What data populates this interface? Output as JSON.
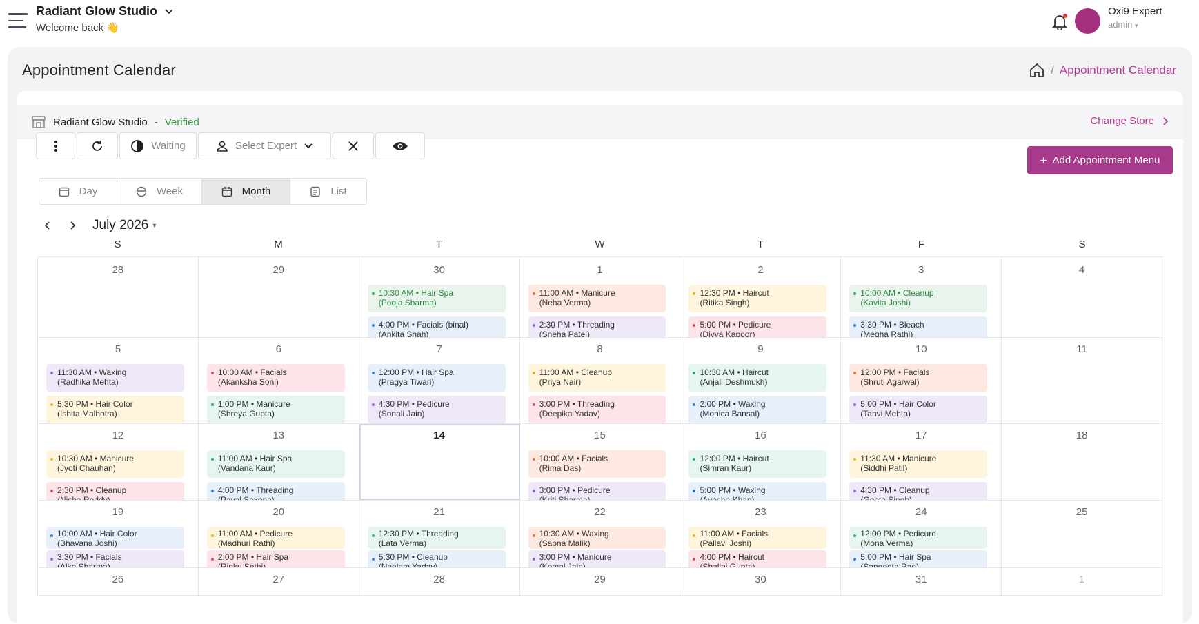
{
  "header": {
    "studio": "Radiant Glow Studio",
    "welcome": "Welcome back 👋",
    "user_name": "Oxi9 Expert",
    "user_role": "admin"
  },
  "page": {
    "title": "Appointment Calendar",
    "breadcrumb_sep": "/",
    "breadcrumb_current": "Appointment Calendar"
  },
  "store": {
    "name": "Radiant Glow Studio",
    "dash": "-",
    "status": "Verified",
    "change": "Change Store"
  },
  "toolbar": {
    "waiting": "Waiting",
    "select_expert": "Select Expert",
    "add_label": "Add Appointment Menu"
  },
  "views": [
    "Day",
    "Week",
    "Month",
    "List"
  ],
  "calendar": {
    "month_label": "July 2026",
    "dow": [
      "S",
      "M",
      "T",
      "W",
      "T",
      "F",
      "S"
    ],
    "weeks": [
      [
        {
          "d": "28",
          "muted": false,
          "appts": []
        },
        {
          "d": "29",
          "muted": false,
          "appts": []
        },
        {
          "d": "30",
          "appts": [
            {
              "t": "10:30 AM • Hair Spa",
              "n": "(Pooja Sharma)",
              "c": "green"
            },
            {
              "t": "4:00 PM • Facials (binal)",
              "n": "(Ankita Shah)",
              "c": "blue"
            }
          ]
        },
        {
          "d": "1",
          "appts": [
            {
              "t": "11:00 AM • Manicure",
              "n": "(Neha Verma)",
              "c": "orange"
            },
            {
              "t": "2:30 PM • Threading",
              "n": "(Sneha Patel)",
              "c": "purple"
            }
          ]
        },
        {
          "d": "2",
          "appts": [
            {
              "t": "12:30 PM • Haircut",
              "n": "(Ritika Singh)",
              "c": "yellow"
            },
            {
              "t": "5:00 PM • Pedicure",
              "n": "(Divya Kapoor)",
              "c": "pink"
            }
          ]
        },
        {
          "d": "3",
          "appts": [
            {
              "t": "10:00 AM • Cleanup",
              "n": "(Kavita Joshi)",
              "c": "green"
            },
            {
              "t": "3:30 PM • Bleach",
              "n": "(Megha Rathi)",
              "c": "blue"
            }
          ]
        },
        {
          "d": "4",
          "appts": []
        }
      ],
      [
        {
          "d": "5",
          "appts": [
            {
              "t": "11:30 AM • Waxing",
              "n": "(Radhika Mehta)",
              "c": "purple"
            },
            {
              "t": "5:30 PM • Hair Color",
              "n": "(Ishita Malhotra)",
              "c": "yellow"
            }
          ]
        },
        {
          "d": "6",
          "appts": [
            {
              "t": "10:00 AM • Facials",
              "n": "(Akanksha Soni)",
              "c": "pink"
            },
            {
              "t": "1:00 PM • Manicure",
              "n": "(Shreya Gupta)",
              "c": "teal"
            }
          ]
        },
        {
          "d": "7",
          "appts": [
            {
              "t": "12:00 PM • Hair Spa",
              "n": "(Pragya Tiwari)",
              "c": "blue"
            },
            {
              "t": "4:30 PM • Pedicure",
              "n": "(Sonali Jain)",
              "c": "purple"
            }
          ]
        },
        {
          "d": "8",
          "appts": [
            {
              "t": "11:00 AM • Cleanup",
              "n": "(Priya Nair)",
              "c": "yellow"
            },
            {
              "t": "3:00 PM • Threading",
              "n": "(Deepika Yadav)",
              "c": "pink"
            }
          ]
        },
        {
          "d": "9",
          "appts": [
            {
              "t": "10:30 AM • Haircut",
              "n": "(Anjali Deshmukh)",
              "c": "teal"
            },
            {
              "t": "2:00 PM • Waxing",
              "n": "(Monica Bansal)",
              "c": "blue"
            }
          ]
        },
        {
          "d": "10",
          "appts": [
            {
              "t": "12:00 PM • Facials",
              "n": "(Shruti Agarwal)",
              "c": "orange"
            },
            {
              "t": "5:00 PM • Hair Color",
              "n": "(Tanvi Mehta)",
              "c": "purple"
            }
          ]
        },
        {
          "d": "11",
          "appts": []
        }
      ],
      [
        {
          "d": "12",
          "appts": [
            {
              "t": "10:30 AM • Manicure",
              "n": "(Jyoti Chauhan)",
              "c": "yellow"
            },
            {
              "t": "2:30 PM • Cleanup",
              "n": "(Nisha Reddy)",
              "c": "pink"
            }
          ]
        },
        {
          "d": "13",
          "appts": [
            {
              "t": "11:00 AM • Hair Spa",
              "n": "(Vandana Kaur)",
              "c": "teal"
            },
            {
              "t": "4:00 PM • Threading",
              "n": "(Payal Saxena)",
              "c": "blue"
            }
          ]
        },
        {
          "d": "14",
          "today": true,
          "appts": []
        },
        {
          "d": "15",
          "appts": [
            {
              "t": "10:00 AM • Facials",
              "n": "(Rima Das)",
              "c": "orange"
            },
            {
              "t": "3:00 PM • Pedicure",
              "n": "(Kriti Sharma)",
              "c": "purple"
            }
          ]
        },
        {
          "d": "16",
          "appts": [
            {
              "t": "12:00 PM • Haircut",
              "n": "(Simran Kaur)",
              "c": "teal"
            },
            {
              "t": "5:00 PM • Waxing",
              "n": "(Ayesha Khan)",
              "c": "blue"
            }
          ]
        },
        {
          "d": "17",
          "appts": [
            {
              "t": "11:30 AM • Manicure",
              "n": "(Siddhi Patil)",
              "c": "yellow"
            },
            {
              "t": "4:30 PM • Cleanup",
              "n": "(Geeta Singh)",
              "c": "purple"
            }
          ]
        },
        {
          "d": "18",
          "appts": []
        }
      ],
      [
        {
          "d": "19",
          "appts": [
            {
              "t": "10:00 AM • Hair Color",
              "n": "(Bhavana Joshi)",
              "c": "blue"
            },
            {
              "t": "3:30 PM • Facials",
              "n": "(Alka Sharma)",
              "c": "purple"
            }
          ]
        },
        {
          "d": "20",
          "appts": [
            {
              "t": "11:00 AM • Pedicure",
              "n": "(Madhuri Rathi)",
              "c": "yellow"
            },
            {
              "t": "2:00 PM • Hair Spa",
              "n": "(Rinku Sethi)",
              "c": "pink"
            }
          ]
        },
        {
          "d": "21",
          "appts": [
            {
              "t": "12:30 PM • Threading",
              "n": "(Lata Verma)",
              "c": "teal"
            },
            {
              "t": "5:30 PM • Cleanup",
              "n": "(Neelam Yadav)",
              "c": "blue"
            }
          ]
        },
        {
          "d": "22",
          "appts": [
            {
              "t": "10:30 AM • Waxing",
              "n": "(Sapna Malik)",
              "c": "orange"
            },
            {
              "t": "3:00 PM • Manicure",
              "n": "(Komal Jain)",
              "c": "purple"
            }
          ]
        },
        {
          "d": "23",
          "appts": [
            {
              "t": "11:00 AM • Facials",
              "n": "(Pallavi Joshi)",
              "c": "yellow"
            },
            {
              "t": "4:00 PM • Haircut",
              "n": "(Shalini Gupta)",
              "c": "pink"
            }
          ]
        },
        {
          "d": "24",
          "appts": [
            {
              "t": "12:00 PM • Pedicure",
              "n": "(Mona Verma)",
              "c": "teal"
            },
            {
              "t": "5:00 PM • Hair Spa",
              "n": "(Sangeeta Rao)",
              "c": "blue"
            }
          ]
        },
        {
          "d": "25",
          "appts": []
        }
      ],
      [
        {
          "d": "26",
          "appts": []
        },
        {
          "d": "27",
          "appts": []
        },
        {
          "d": "28",
          "appts": []
        },
        {
          "d": "29",
          "appts": []
        },
        {
          "d": "30",
          "appts": []
        },
        {
          "d": "31",
          "appts": []
        },
        {
          "d": "1",
          "muted": true,
          "appts": []
        }
      ]
    ]
  },
  "colors": {
    "accent": "#a83a8b",
    "verified": "#3a9a45",
    "link": "#b03a92"
  }
}
